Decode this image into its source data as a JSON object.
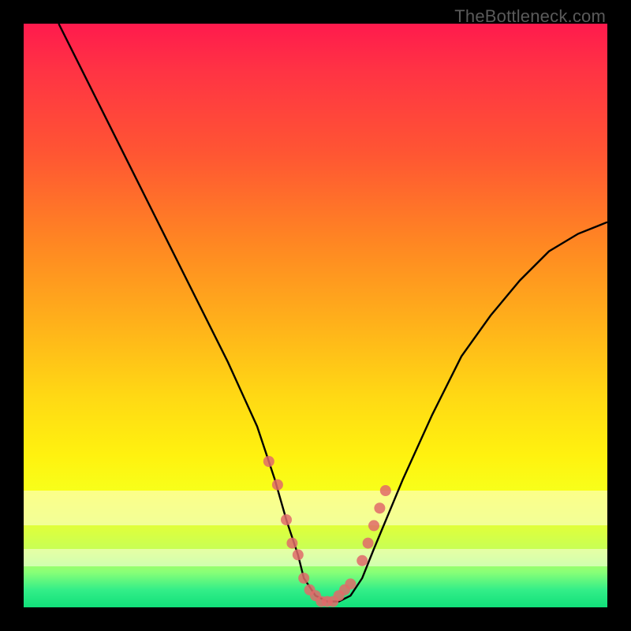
{
  "watermark": "TheBottleneck.com",
  "chart_data": {
    "type": "line",
    "title": "",
    "xlabel": "",
    "ylabel": "",
    "xlim": [
      0,
      100
    ],
    "ylim": [
      0,
      100
    ],
    "grid": false,
    "legend": false,
    "series": [
      {
        "name": "bottleneck-curve",
        "x": [
          6,
          10,
          15,
          20,
          25,
          30,
          35,
          40,
          43,
          45,
          47,
          48,
          50,
          52,
          54,
          56,
          58,
          60,
          65,
          70,
          75,
          80,
          85,
          90,
          95,
          100
        ],
        "y": [
          100,
          92,
          82,
          72,
          62,
          52,
          42,
          31,
          22,
          15,
          9,
          5,
          2,
          1,
          1,
          2,
          5,
          10,
          22,
          33,
          43,
          50,
          56,
          61,
          64,
          66
        ]
      }
    ],
    "highlight_points": {
      "name": "marker-dots",
      "x": [
        42,
        43.5,
        45,
        46,
        47,
        48,
        49,
        50,
        51,
        52,
        53,
        54,
        55,
        56,
        58,
        59,
        60,
        61,
        62
      ],
      "y": [
        25,
        21,
        15,
        11,
        9,
        5,
        3,
        2,
        1,
        1,
        1,
        2,
        3,
        4,
        8,
        11,
        14,
        17,
        20
      ]
    },
    "pale_bands_y": [
      {
        "from": 14,
        "to": 20
      },
      {
        "from": 7,
        "to": 10
      }
    ],
    "gradient_stops": [
      {
        "pos": 0,
        "color": "#ff1a4d"
      },
      {
        "pos": 50,
        "color": "#ffb31a"
      },
      {
        "pos": 78,
        "color": "#fff20f"
      },
      {
        "pos": 100,
        "color": "#11e07a"
      }
    ]
  }
}
